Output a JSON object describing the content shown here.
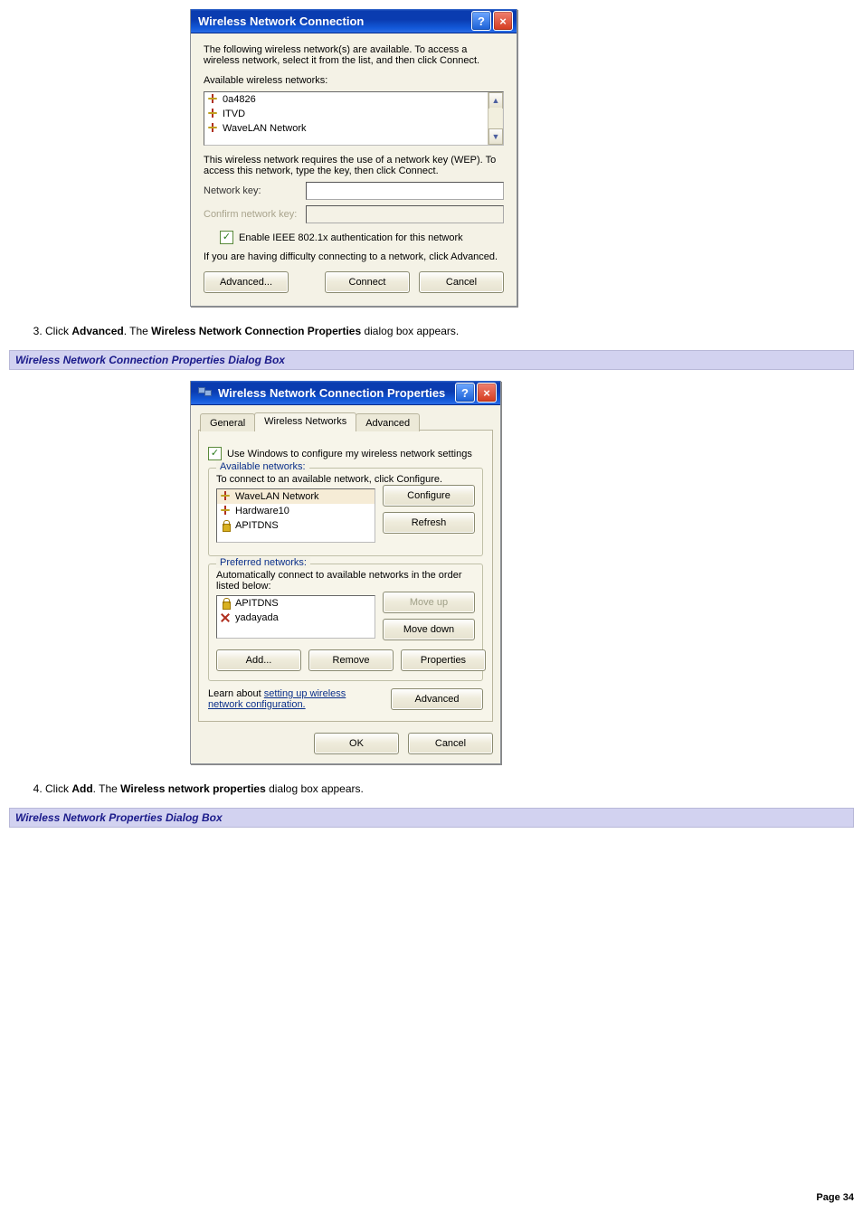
{
  "dialog1": {
    "title": "Wireless Network Connection",
    "intro": "The following wireless network(s) are available. To access a wireless network, select it from the list, and then click Connect.",
    "available_label": "Available wireless networks:",
    "networks": [
      "0a4826",
      "ITVD",
      "WaveLAN Network"
    ],
    "wep_note": "This wireless network requires the use of a network key (WEP). To access this network, type the key, then click Connect.",
    "network_key_label": "Network key:",
    "confirm_key_label": "Confirm network key:",
    "enable_8021x_label": "Enable IEEE 802.1x authentication for this network",
    "difficulty_note": "If you are having difficulty connecting to a network, click Advanced.",
    "btn_advanced": "Advanced...",
    "btn_connect": "Connect",
    "btn_cancel": "Cancel"
  },
  "step3": {
    "pre": "Click ",
    "bold1": "Advanced",
    "mid": ". The ",
    "bold2": "Wireless Network Connection Properties",
    "post": " dialog box appears."
  },
  "section1_heading": "Wireless Network Connection Properties Dialog Box",
  "dialog2": {
    "title": "Wireless Network Connection Properties",
    "tabs": {
      "general": "General",
      "wireless": "Wireless Networks",
      "advanced": "Advanced"
    },
    "use_windows": "Use Windows to configure my wireless network settings",
    "available_legend": "Available networks:",
    "available_hint": "To connect to an available network, click Configure.",
    "available_list": [
      "WaveLAN Network",
      "Hardware10",
      "APITDNS"
    ],
    "btn_configure": "Configure",
    "btn_refresh": "Refresh",
    "preferred_legend": "Preferred networks:",
    "preferred_hint": "Automatically connect to available networks in the order listed below:",
    "preferred_list": [
      "APITDNS",
      "yadayada"
    ],
    "btn_moveup": "Move up",
    "btn_movedown": "Move down",
    "btn_add": "Add...",
    "btn_remove": "Remove",
    "btn_properties": "Properties",
    "learn_pre": "Learn about ",
    "learn_link": "setting up wireless network configuration.",
    "btn_advanced": "Advanced",
    "btn_ok": "OK",
    "btn_cancel": "Cancel"
  },
  "step4": {
    "pre": "Click ",
    "bold1": "Add",
    "mid": ". The ",
    "bold2": "Wireless network properties",
    "post": " dialog box appears."
  },
  "section2_heading": "Wireless Network Properties Dialog Box",
  "page_footer": "Page 34"
}
